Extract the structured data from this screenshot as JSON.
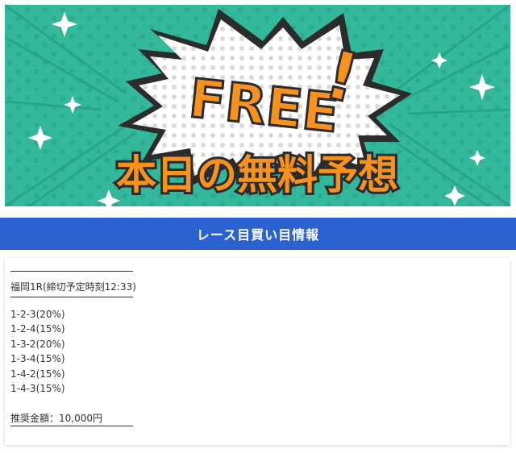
{
  "banner": {
    "free_text": "FREE",
    "exclaim": "!",
    "title": "本日の無料予想",
    "colors": {
      "teal": "#33b89b",
      "orange": "#f7921e",
      "dark": "#2b2b2b"
    }
  },
  "section": {
    "title": "レース目買い目情報"
  },
  "race": {
    "header": "福岡1R(締切予定時刻12:33)",
    "picks": [
      "1-2-3(20%)",
      "1-2-4(15%)",
      "1-3-2(20%)",
      "1-3-4(15%)",
      "1-4-2(15%)",
      "1-4-3(15%)"
    ],
    "recommended": "推奨金額：10,000円"
  }
}
